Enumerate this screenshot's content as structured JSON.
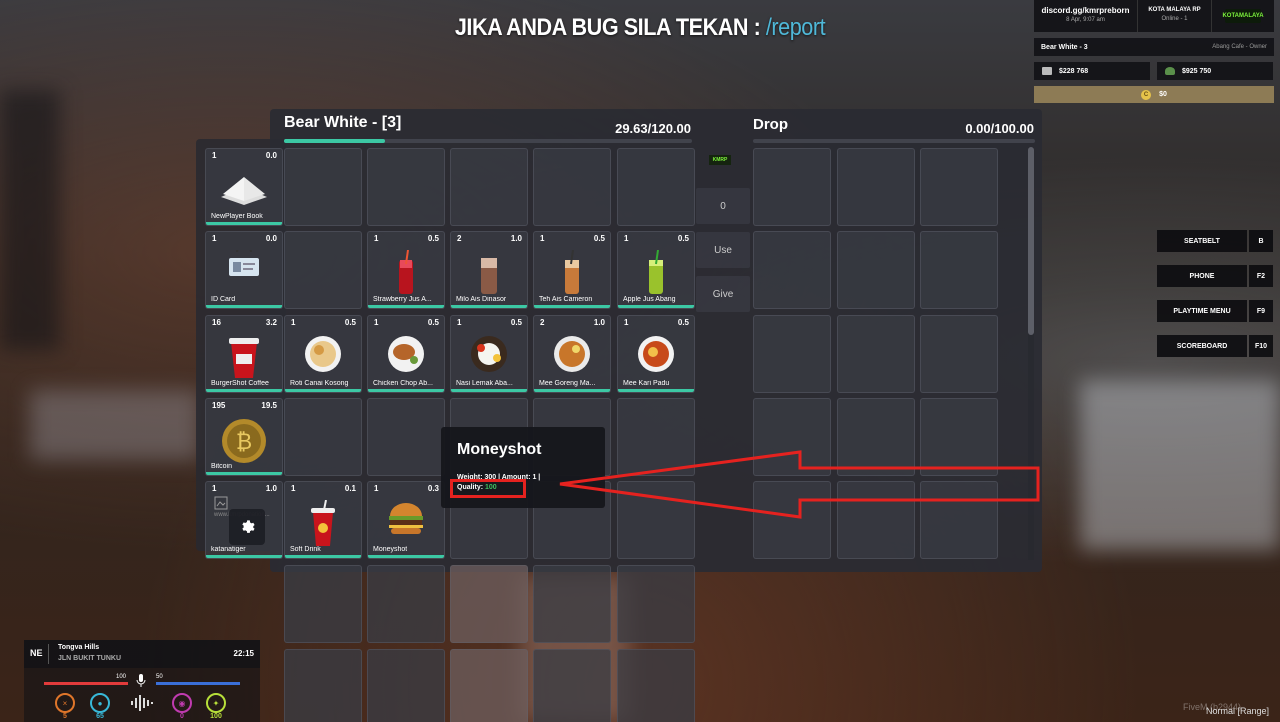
{
  "banner": {
    "prefix": "JIKA ANDA BUG SILA TEKAN : ",
    "command": "/report"
  },
  "server": {
    "discord": "discord.gg/kmrpreborn",
    "datetime": "8 Apr, 9:07 am",
    "name": "KOTA MALAYA RP",
    "online": "Online - 1",
    "logo_text": "KOTAMALAYA"
  },
  "player": {
    "name": "Bear White - 3",
    "job": "Abang Cafe - Owner"
  },
  "money": {
    "bank": "$228 768",
    "black": "$925 750",
    "cash": "$0"
  },
  "keybinds": [
    {
      "label": "SEATBELT",
      "key": "B"
    },
    {
      "label": "PHONE",
      "key": "F2"
    },
    {
      "label": "PLAYTIME MENU",
      "key": "F9"
    },
    {
      "label": "SCOREBOARD",
      "key": "F10"
    }
  ],
  "inventory": {
    "title": "Bear White - [3]",
    "weight": "29.63/120.00",
    "weight_fraction": 0.247,
    "items": [
      {
        "count": "1",
        "weight": "0.0",
        "name": "NewPlayer Book",
        "icon": "book"
      },
      {
        "count": "1",
        "weight": "0.0",
        "name": "ID Card",
        "icon": "id-card"
      },
      {
        "count": "1",
        "weight": "0.5",
        "name": "Strawberry Jus A...",
        "icon": "strawberry-juice"
      },
      {
        "count": "2",
        "weight": "1.0",
        "name": "Milo Ais Dinasor",
        "icon": "milo-drink"
      },
      {
        "count": "1",
        "weight": "0.5",
        "name": "Teh Ais Cameron",
        "icon": "iced-tea"
      },
      {
        "count": "1",
        "weight": "0.5",
        "name": "Apple Jus Abang",
        "icon": "apple-juice"
      },
      {
        "count": "16",
        "weight": "3.2",
        "name": "BurgerShot Coffee",
        "icon": "coffee-cup"
      },
      {
        "count": "1",
        "weight": "0.5",
        "name": "Roti Canai Kosong",
        "icon": "roti-canai"
      },
      {
        "count": "1",
        "weight": "0.5",
        "name": "Chicken Chop Ab...",
        "icon": "chicken-chop"
      },
      {
        "count": "1",
        "weight": "0.5",
        "name": "Nasi Lemak Aba...",
        "icon": "nasi-lemak"
      },
      {
        "count": "2",
        "weight": "1.0",
        "name": "Mee Goreng Ma...",
        "icon": "mee-goreng"
      },
      {
        "count": "1",
        "weight": "0.5",
        "name": "Mee Kari Padu",
        "icon": "mee-kari"
      },
      {
        "count": "195",
        "weight": "19.5",
        "name": "Bitcoin",
        "icon": "bitcoin"
      },
      {
        "count": "1",
        "weight": "1.0",
        "name": "katanatiger",
        "icon": "broken-image",
        "alt_text": "www.kmrpdonation..."
      },
      {
        "count": "1",
        "weight": "0.1",
        "name": "Soft Drink",
        "icon": "soft-drink"
      },
      {
        "count": "1",
        "weight": "0.3",
        "name": "Moneyshot",
        "icon": "burger"
      }
    ]
  },
  "drop": {
    "title": "Drop",
    "weight": "0.00/100.00"
  },
  "controls": {
    "logo": "KMRP",
    "amount": "0",
    "use": "Use",
    "give": "Give"
  },
  "tooltip": {
    "title": "Moneyshot",
    "line_weight_label": "Weight: ",
    "line_weight": "300 | Amount: 1 |",
    "quality_label": "Quality: ",
    "quality_value": "100"
  },
  "hud": {
    "direction": "NE",
    "street": "Tongva Hills",
    "area": "JLN BUKIT TUNKU",
    "time": "22:15",
    "health": "100",
    "armor": "50",
    "stats": [
      {
        "icon": "hunger-icon",
        "value": "5",
        "color": "#e0762a"
      },
      {
        "icon": "thirst-icon",
        "value": "65",
        "color": "#38b8d8"
      },
      {
        "icon": "stress-icon",
        "value": "0",
        "color": "#c03bb0"
      },
      {
        "icon": "stamina-icon",
        "value": "100",
        "color": "#b8e03a"
      }
    ]
  },
  "footer": {
    "fivem": "FiveM (b2944)",
    "voice": "Normal [Range]"
  },
  "colors": {
    "accent": "#3cc8a4",
    "annotation": "#e5221f",
    "command": "#4fb8d8"
  }
}
